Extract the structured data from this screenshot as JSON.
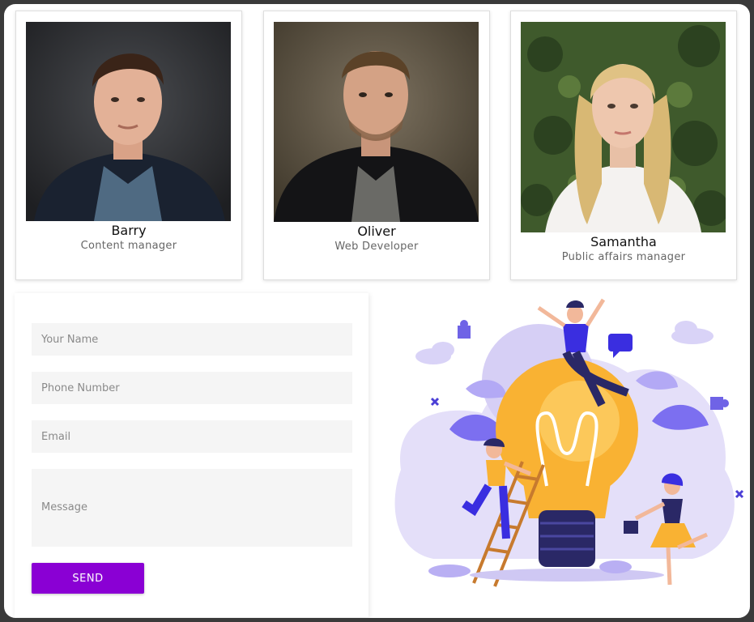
{
  "team": [
    {
      "name": "Barry",
      "role": "Content manager",
      "photo_icon": "person-photo-barry"
    },
    {
      "name": "Oliver",
      "role": "Web Developer",
      "photo_icon": "person-photo-oliver"
    },
    {
      "name": "Samantha",
      "role": "Public affairs manager",
      "photo_icon": "person-photo-samantha"
    }
  ],
  "form": {
    "name_placeholder": "Your Name",
    "phone_placeholder": "Phone Number",
    "email_placeholder": "Email",
    "message_placeholder": "Message",
    "send_label": "SEND"
  },
  "illustration": {
    "icon": "lightbulb-teamwork-illustration"
  },
  "colors": {
    "accent": "#8a00d4",
    "bulb": "#f9b233",
    "lavender": "#d9d3f7",
    "indigo": "#3a2ee0"
  }
}
